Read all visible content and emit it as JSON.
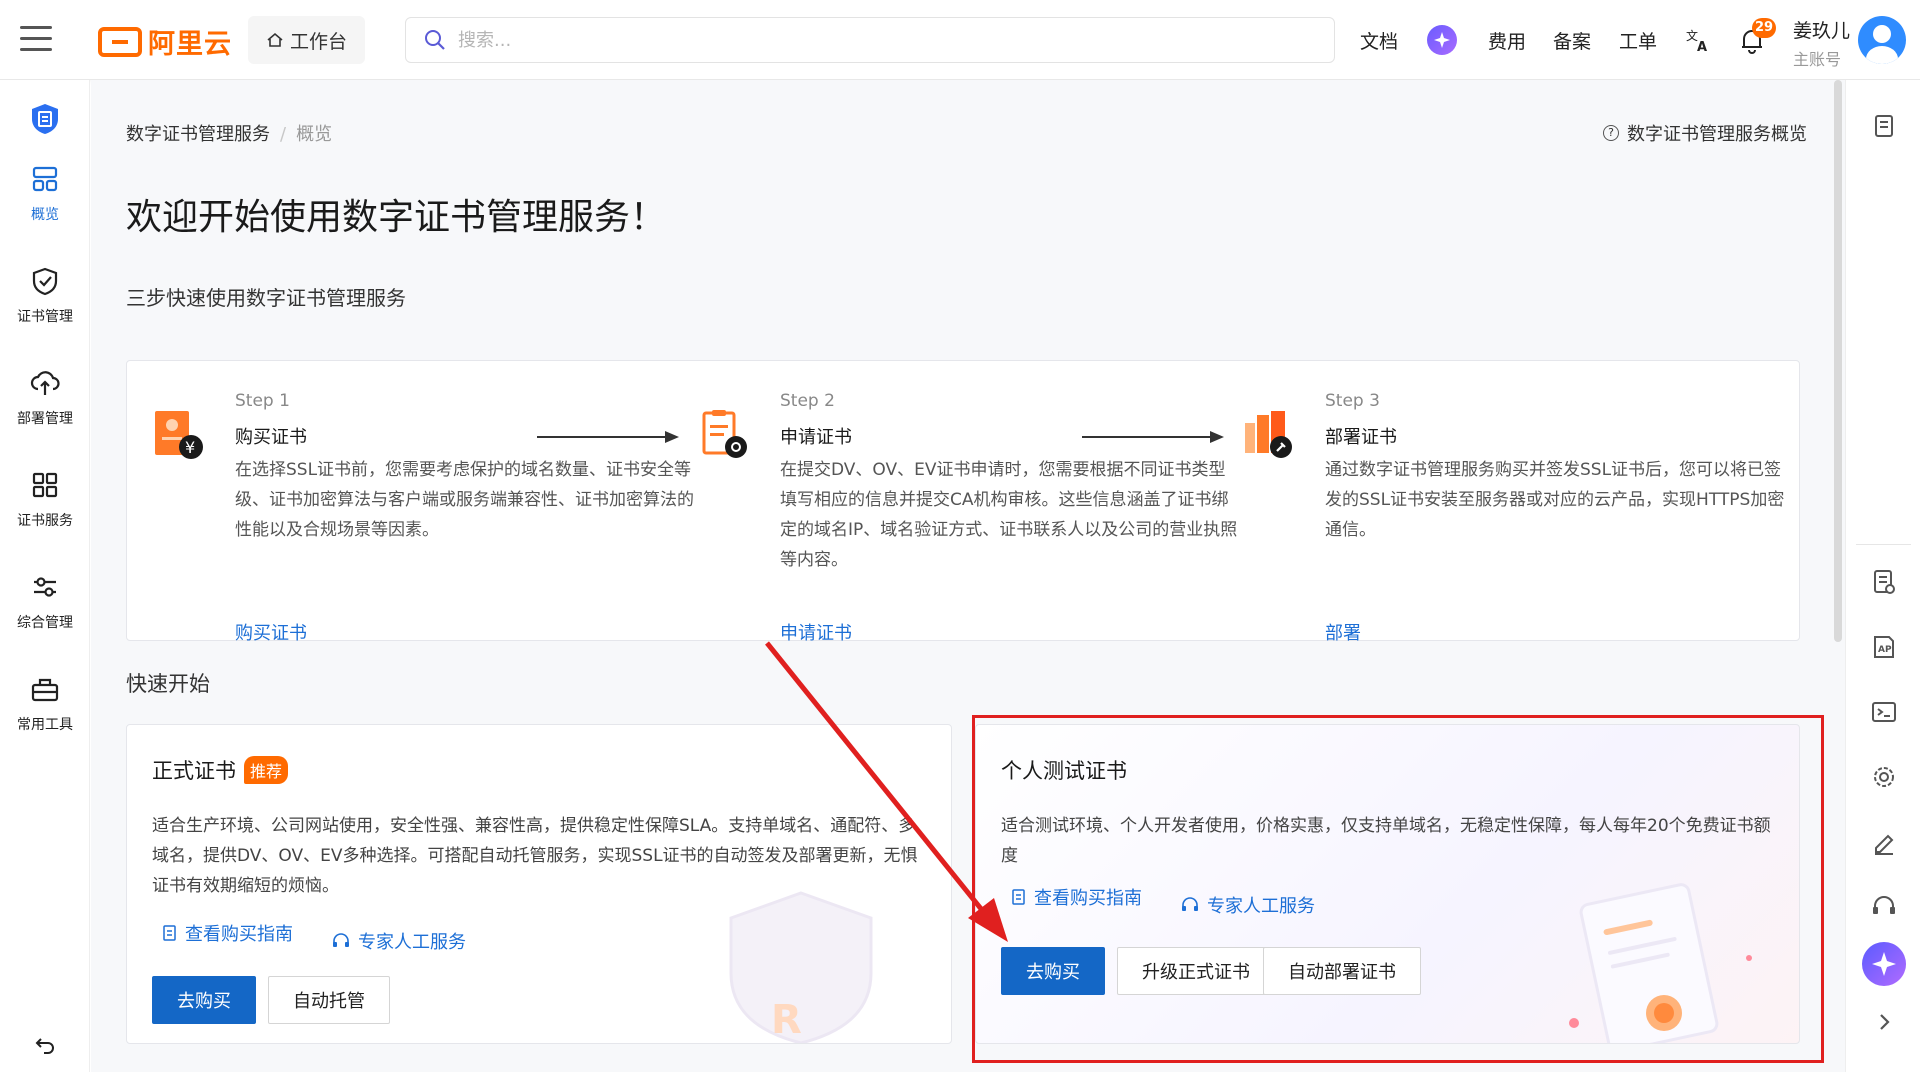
{
  "header": {
    "logo_text": "阿里云",
    "workbench": "工作台",
    "search_placeholder": "搜索...",
    "nav": [
      "文档",
      "费用",
      "备案",
      "工单"
    ],
    "notification_count": "29",
    "username": "姜玖儿",
    "account_type": "主账号"
  },
  "sidebar": {
    "items": [
      {
        "label": "概览",
        "icon": "dashboard-icon"
      },
      {
        "label": "证书管理",
        "icon": "shield-check-icon"
      },
      {
        "label": "部署管理",
        "icon": "cloud-upload-icon"
      },
      {
        "label": "证书服务",
        "icon": "grid-icon"
      },
      {
        "label": "综合管理",
        "icon": "sliders-icon"
      },
      {
        "label": "常用工具",
        "icon": "toolbox-icon"
      }
    ],
    "active": "概览"
  },
  "breadcrumb": {
    "root": "数字证书管理服务",
    "current": "概览"
  },
  "overview_link": "数字证书管理服务概览",
  "page_title": "欢迎开始使用数字证书管理服务！",
  "subtitle": "三步快速使用数字证书管理服务",
  "steps": [
    {
      "no": "Step 1",
      "name": "购买证书",
      "desc": "在选择SSL证书前，您需要考虑保护的域名数量、证书安全等级、证书加密算法与客户端或服务端兼容性、证书加密算法的性能以及合规场景等因素。",
      "link": "购买证书"
    },
    {
      "no": "Step 2",
      "name": "申请证书",
      "desc": "在提交DV、OV、EV证书申请时，您需要根据不同证书类型填写相应的信息并提交CA机构审核。这些信息涵盖了证书绑定的域名IP、域名验证方式、证书联系人以及公司的营业执照等内容。",
      "link": "申请证书"
    },
    {
      "no": "Step 3",
      "name": "部署证书",
      "desc": "通过数字证书管理服务购买并签发SSL证书后，您可以将已签发的SSL证书安装至服务器或对应的云产品，实现HTTPS加密通信。",
      "link": "部署"
    }
  ],
  "quick_start": {
    "title": "快速开始",
    "formal": {
      "title": "正式证书",
      "badge": "推荐",
      "desc": "适合生产环境、公司网站使用，安全性强、兼容性高，提供稳定性保障SLA。支持单域名、通配符、多域名，提供DV、OV、EV多种选择。可搭配自动托管服务，实现SSL证书的自动签发及部署更新，无惧证书有效期缩短的烦恼。",
      "link_guide": "查看购买指南",
      "link_expert": "专家人工服务",
      "btn_buy": "去购买",
      "btn_managed": "自动托管"
    },
    "personal": {
      "title": "个人测试证书",
      "desc": "适合测试环境、个人开发者使用，价格实惠，仅支持单域名，无稳定性保障，每人每年20个免费证书额度",
      "link_guide": "查看购买指南",
      "link_expert": "专家人工服务",
      "btn_buy": "去购买",
      "btn_upgrade": "升级正式证书",
      "btn_deploy": "自动部署证书"
    }
  },
  "colors": {
    "brand": "#ff6a00",
    "primary": "#1467c6",
    "link": "#1d6fd6",
    "annotation": "#e0201f"
  }
}
